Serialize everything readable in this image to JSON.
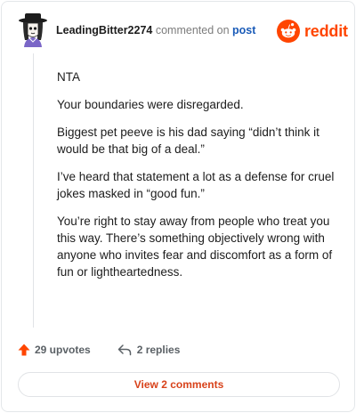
{
  "header": {
    "username": "LeadingBitter2274",
    "action_text": "commented on",
    "post_link": "post"
  },
  "brand": {
    "wordmark": "reddit",
    "color": "#ff4500",
    "logo_icon": "reddit-snoo-icon"
  },
  "comment": {
    "paragraphs": [
      "NTA",
      "Your boundaries were disregarded.",
      "Biggest pet peeve is his dad saying “didn’t think it would be that big of a deal.”",
      "I’ve heard that statement a lot as a defense for cruel jokes masked in “good fun.”",
      "You’re right to stay away from people who treat you this way. There’s something objectively wrong with anyone who invites fear and discomfort as a form of fun or lightheartedness."
    ]
  },
  "stats": {
    "upvotes": "29 upvotes",
    "upvote_icon": "upvote-arrow-icon",
    "upvote_color": "#ff4500",
    "replies": "2 replies",
    "reply_icon": "reply-arrow-icon"
  },
  "footer": {
    "view_comments_label": "View 2 comments",
    "button_text_color": "#d8421a"
  }
}
